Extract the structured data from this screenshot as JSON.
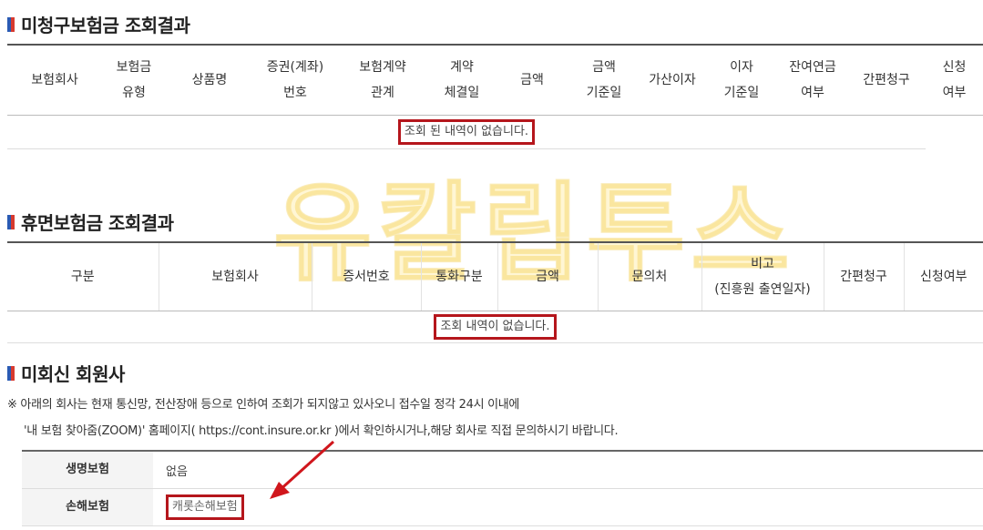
{
  "sections": {
    "unclaimed": {
      "title": "미청구보험금 조회결과",
      "headers": [
        {
          "l1": "보험회사",
          "l2": ""
        },
        {
          "l1": "보험금",
          "l2": "유형"
        },
        {
          "l1": "상품명",
          "l2": ""
        },
        {
          "l1": "증권(계좌)",
          "l2": "번호"
        },
        {
          "l1": "보험계약",
          "l2": "관계"
        },
        {
          "l1": "계약",
          "l2": "체결일"
        },
        {
          "l1": "금액",
          "l2": ""
        },
        {
          "l1": "금액",
          "l2": "기준일"
        },
        {
          "l1": "가산이자",
          "l2": ""
        },
        {
          "l1": "이자",
          "l2": "기준일"
        },
        {
          "l1": "잔여연금",
          "l2": "여부"
        },
        {
          "l1": "간편청구",
          "l2": ""
        },
        {
          "l1": "신청",
          "l2": "여부"
        }
      ],
      "empty_message": "조회 된 내역이 없습니다."
    },
    "dormant": {
      "title": "휴면보험금 조회결과",
      "headers": [
        {
          "l1": "구분",
          "l2": ""
        },
        {
          "l1": "보험회사",
          "l2": ""
        },
        {
          "l1": "증서번호",
          "l2": ""
        },
        {
          "l1": "통화구분",
          "l2": ""
        },
        {
          "l1": "금액",
          "l2": ""
        },
        {
          "l1": "문의처",
          "l2": ""
        },
        {
          "l1": "비고",
          "l2": "(진흥원 출연일자)"
        },
        {
          "l1": "간편청구",
          "l2": ""
        },
        {
          "l1": "신청여부",
          "l2": ""
        }
      ],
      "empty_message": "조회 내역이 없습니다."
    },
    "no_response": {
      "title": "미회신 회원사",
      "note_line1": "※ 아래의 회사는 현재 통신망, 전산장애 등으로 인하여 조회가 되지않고 있사오니 접수일 정각 24시 이내에",
      "note_line2": "'내 보험 찾아줌(ZOOM)' 홈페이지( https://cont.insure.or.kr )에서 확인하시거나,해당 회사로 직접 문의하시기 바랍니다.",
      "rows": [
        {
          "label": "생명보험",
          "value": "없음"
        },
        {
          "label": "손해보험",
          "value": "캐롯손해보험"
        }
      ]
    }
  },
  "watermark": "유칼립투스",
  "colors": {
    "highlight": "#b5161c",
    "marker_blue": "#2a5bb4",
    "marker_red": "#d73a2f",
    "watermark": "#ffd63c"
  }
}
